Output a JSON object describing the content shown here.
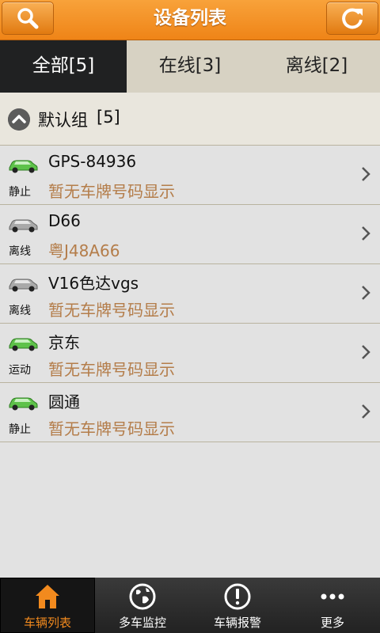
{
  "header": {
    "title": "设备列表"
  },
  "tabs": [
    {
      "label": "全部[5]",
      "active": true
    },
    {
      "label": "在线[3]",
      "active": false
    },
    {
      "label": "离线[2]",
      "active": false
    }
  ],
  "group": {
    "label": "默认组",
    "count": "[5]"
  },
  "devices": [
    {
      "name": "GPS-84936",
      "plate": "暂无车牌号码显示",
      "status": "静止",
      "car_color": "green"
    },
    {
      "name": "D66",
      "plate": "粤J48A66",
      "status": "离线",
      "car_color": "gray"
    },
    {
      "name": "V16色达vgs",
      "plate": "暂无车牌号码显示",
      "status": "离线",
      "car_color": "gray"
    },
    {
      "name": "京东",
      "plate": "暂无车牌号码显示",
      "status": "运动",
      "car_color": "green"
    },
    {
      "name": "圆通",
      "plate": "暂无车牌号码显示",
      "status": "静止",
      "car_color": "green"
    }
  ],
  "bottom_nav": [
    {
      "label": "车辆列表",
      "icon": "home-icon",
      "active": true
    },
    {
      "label": "多车监控",
      "icon": "globe-icon",
      "active": false
    },
    {
      "label": "车辆报警",
      "icon": "alert-icon",
      "active": false
    },
    {
      "label": "更多",
      "icon": "more-icon",
      "active": false
    }
  ],
  "colors": {
    "accent": "#ef8417",
    "plate_text": "#b47d4a",
    "active_tab": "#202122",
    "car_green": "#5ec24a",
    "car_gray": "#a9a9a9"
  }
}
